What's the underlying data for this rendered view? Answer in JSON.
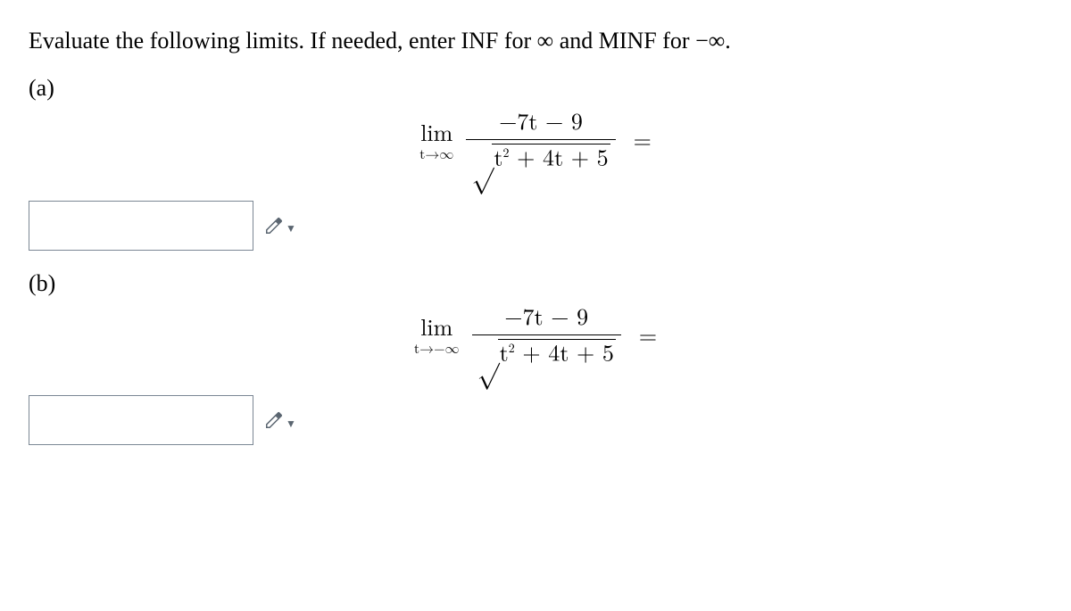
{
  "instruction": "Evaluate the following limits. If needed, enter INF for ∞ and MINF for −∞.",
  "parts": {
    "a": {
      "label": "(a)",
      "lim_text": "lim",
      "lim_sub": "t→∞",
      "numerator": "−7t − 9",
      "sqrt_symbol": "√",
      "denominator_inner_pre": "t",
      "denominator_inner_exp": "2",
      "denominator_inner_post": " + 4t + 5",
      "equals": "=",
      "answer_value": ""
    },
    "b": {
      "label": "(b)",
      "lim_text": "lim",
      "lim_sub": "t→−∞",
      "numerator": "−7t − 9",
      "sqrt_symbol": "√",
      "denominator_inner_pre": "t",
      "denominator_inner_exp": "2",
      "denominator_inner_post": " + 4t + 5",
      "equals": "=",
      "answer_value": ""
    }
  },
  "icons": {
    "chevron": "▼"
  }
}
